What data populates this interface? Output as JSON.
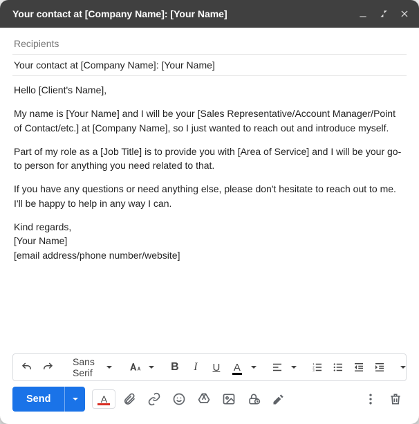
{
  "window": {
    "title": "Your contact at [Company Name]: [Your Name]"
  },
  "fields": {
    "recipients_placeholder": "Recipients",
    "subject": "Your contact at [Company Name]: [Your Name]"
  },
  "body": {
    "p1": "Hello [Client's Name],",
    "p2": "My name is [Your Name] and I will be your [Sales Representative/Account Manager/Point of Contact/etc.] at [Company Name], so I just wanted to reach out and introduce myself.",
    "p3": "Part of my role as a [Job Title] is to provide you with [Area of Service] and I will be your go-to person for anything you need related to that.",
    "p4": "If you have any questions or need anything else, please don't hesitate to reach out to me. I'll be happy to help in any way I can.",
    "signoff": "Kind regards,",
    "name": "[Your Name]",
    "contact": "[email address/phone number/website]"
  },
  "format_toolbar": {
    "font_label": "Sans Serif"
  },
  "send": {
    "label": "Send"
  }
}
